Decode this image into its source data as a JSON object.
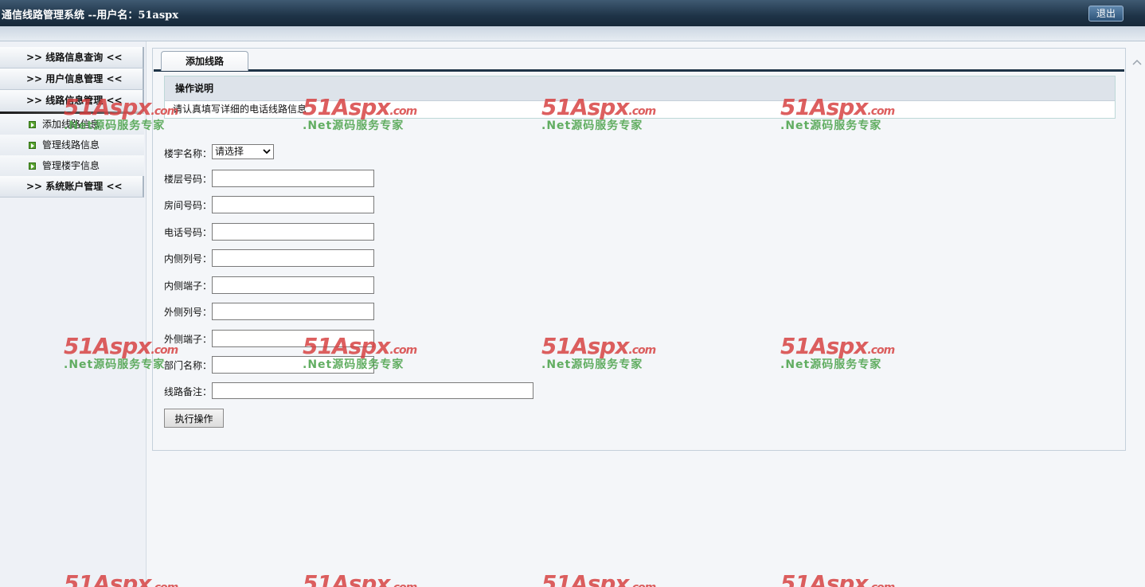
{
  "header": {
    "title": "通信线路管理系统  --用户名：51aspx",
    "logout_label": "退出"
  },
  "sidebar": {
    "items": [
      {
        "label": ">>  线路信息查询  <<"
      },
      {
        "label": ">>  用户信息管理  <<"
      },
      {
        "label": ">>  线路信息管理  <<"
      }
    ],
    "subitems": [
      {
        "label": "添加线路信息"
      },
      {
        "label": "管理线路信息"
      },
      {
        "label": "管理楼宇信息"
      }
    ],
    "last_item": {
      "label": ">>  系统账户管理  <<"
    }
  },
  "main": {
    "tab_label": "添加线路",
    "instructions": {
      "title": "操作说明",
      "text": "请认真填写详细的电话线路信息"
    },
    "form": {
      "building_label": "楼宇名称：",
      "building_value": "请选择",
      "floor_label": "楼层号码：",
      "room_label": "房间号码：",
      "phone_label": "电话号码：",
      "inner_col_label": "内侧列号：",
      "inner_term_label": "内侧端子：",
      "outer_col_label": "外侧列号：",
      "outer_term_label": "外侧端子：",
      "dept_label": "部门名称：",
      "remark_label": "线路备注：",
      "submit_label": "执行操作"
    }
  },
  "watermark": {
    "brand": "51Aspx",
    "suffix": ".com",
    "tagline": ".Net源码服务专家"
  },
  "colors": {
    "header_bg": "#1e3347",
    "watermark_red": "#d63c3c",
    "watermark_green": "#46a046"
  }
}
